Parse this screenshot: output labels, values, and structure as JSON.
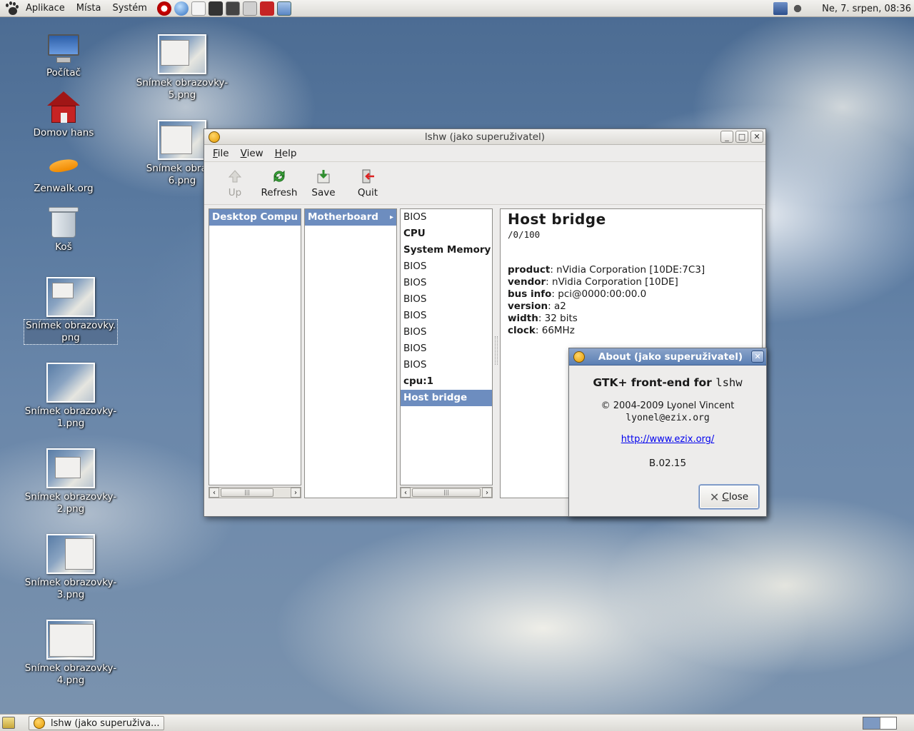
{
  "top_panel": {
    "menus": [
      "Aplikace",
      "Místa",
      "Systém"
    ],
    "clock": "Ne,  7. srpen, 08:36"
  },
  "desktop": {
    "icons": [
      {
        "label": "Počítač"
      },
      {
        "label": "Domov hans"
      },
      {
        "label": "Zenwalk.org"
      },
      {
        "label": "Koš"
      },
      {
        "label": "Snímek obrazovky.\npng"
      },
      {
        "label": "Snímek obrazovky-\n1.png"
      },
      {
        "label": "Snímek obrazovky-\n2.png"
      },
      {
        "label": "Snímek obrazovky-\n3.png"
      },
      {
        "label": "Snímek obrazovky-\n4.png"
      },
      {
        "label": "Snímek obrazovky-\n5.png"
      },
      {
        "label": "Snímek obrazo\n6.png"
      }
    ]
  },
  "main_window": {
    "title": "lshw (jako superuživatel)",
    "menu": [
      "File",
      "View",
      "Help"
    ],
    "toolbar": [
      {
        "label": "Up",
        "icon": "up-arrow-icon",
        "enabled": false
      },
      {
        "label": "Refresh",
        "icon": "refresh-icon",
        "enabled": true
      },
      {
        "label": "Save",
        "icon": "save-icon",
        "enabled": true
      },
      {
        "label": "Quit",
        "icon": "quit-icon",
        "enabled": true
      }
    ],
    "column1": [
      "Desktop Compu"
    ],
    "column2": [
      "Motherboard"
    ],
    "column2_arrow": "▸",
    "column3": [
      {
        "label": "BIOS",
        "bold": false
      },
      {
        "label": "CPU",
        "bold": true
      },
      {
        "label": "System Memory",
        "bold": true
      },
      {
        "label": "BIOS",
        "bold": false
      },
      {
        "label": "BIOS",
        "bold": false
      },
      {
        "label": "BIOS",
        "bold": false
      },
      {
        "label": "BIOS",
        "bold": false
      },
      {
        "label": "BIOS",
        "bold": false
      },
      {
        "label": "BIOS",
        "bold": false
      },
      {
        "label": "BIOS",
        "bold": false
      },
      {
        "label": "cpu:1",
        "bold": true
      },
      {
        "label": "Host bridge",
        "bold": false,
        "selected": true
      }
    ],
    "detail": {
      "title": "Host bridge",
      "path": "/0/100",
      "props": [
        {
          "key": "product",
          "value": "nVidia Corporation [10DE:7C3]"
        },
        {
          "key": "vendor",
          "value": "nVidia Corporation [10DE]"
        },
        {
          "key": "bus info",
          "value": "pci@0000:00:00.0"
        },
        {
          "key": "version",
          "value": "a2"
        },
        {
          "key": "width",
          "value": "32 bits"
        },
        {
          "key": "clock",
          "value": "66MHz"
        }
      ]
    }
  },
  "about_dialog": {
    "title": "About (jako superuživatel)",
    "app_title": "GTK+ front-end for ",
    "app_title_mono": "lshw",
    "copyright": "© 2004-2009 Lyonel Vincent",
    "email": "lyonel@ezix.org",
    "link": "http://www.ezix.org/",
    "version": "B.02.15",
    "close_label": "Close"
  },
  "taskbar": {
    "task_label": "lshw (jako superuživa..."
  }
}
